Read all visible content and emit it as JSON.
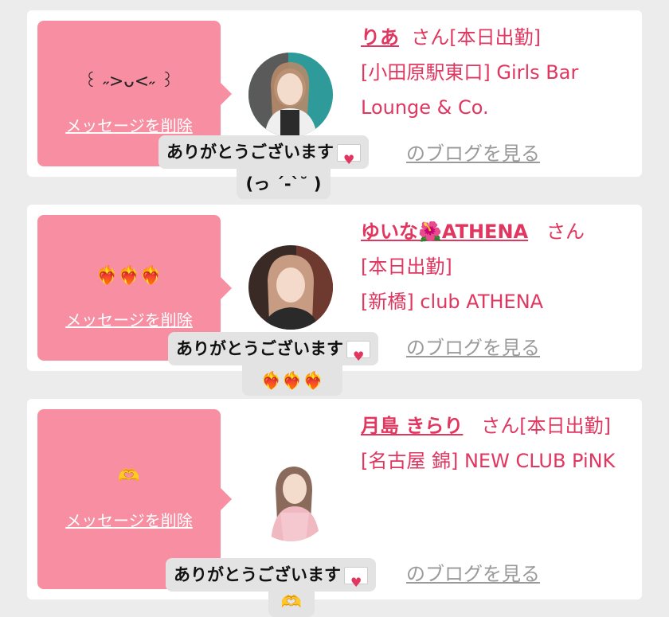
{
  "cards": [
    {
      "message": "꒰ ˶>ᴗ<˶ ꒱",
      "delete_label": "メッセージを削除",
      "name": "りあ",
      "san": "さん",
      "line1_suffix": "[本日出勤]",
      "shop": "[小田原駅東口] Girls Bar Lounge & Co.",
      "blog_label": "のブログを見る",
      "reply": "ありがとうございます",
      "reply_sub": "(っ ´-`˘ )"
    },
    {
      "message": "❤️‍🔥❤️‍🔥❤️‍🔥",
      "delete_label": "メッセージを削除",
      "name": "ゆいな🌺ATHENA",
      "san": "さん",
      "line1_suffix": "[本日出勤]",
      "shop": "[新橋] club ATHENA",
      "blog_label": "のブログを見る",
      "reply": "ありがとうございます",
      "reply_sub": "❤️‍🔥❤️‍🔥❤️‍🔥"
    },
    {
      "message": "🫶",
      "delete_label": "メッセージを削除",
      "name": "月島 きらり",
      "san": "さん",
      "line1_suffix": "[本日出勤]",
      "shop": "[名古屋 錦] NEW CLUB PiNK",
      "blog_label": "のブログを見る",
      "reply": "ありがとうございます",
      "reply_sub": "🫶"
    }
  ],
  "colors": {
    "accent": "#e0365f",
    "message_bg": "#f78ea2",
    "page_bg": "#ececec"
  }
}
